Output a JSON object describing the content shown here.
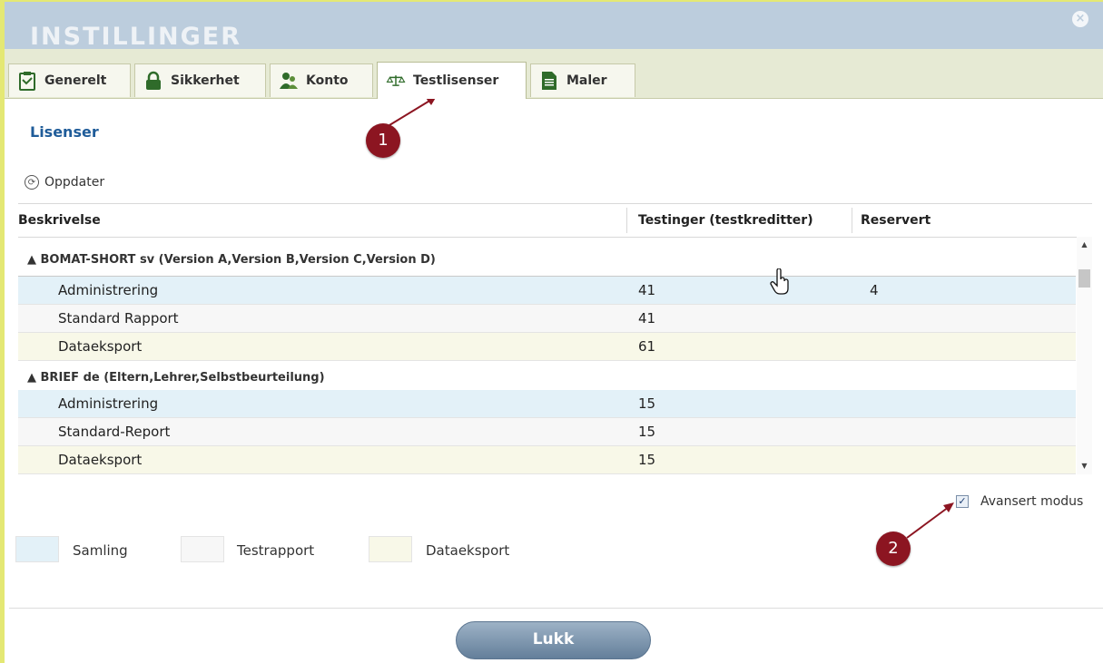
{
  "dialog": {
    "title": "INSTILLINGER",
    "close_symbol": "×"
  },
  "tabs": [
    {
      "label": "Generelt",
      "icon": "clipboard-icon"
    },
    {
      "label": "Sikkerhet",
      "icon": "lock-icon"
    },
    {
      "label": "Konto",
      "icon": "users-icon"
    },
    {
      "label": "Testlisenser",
      "icon": "scale-icon",
      "active": true
    },
    {
      "label": "Maler",
      "icon": "document-icon"
    }
  ],
  "section": {
    "heading": "Lisenser",
    "refresh_label": "Oppdater"
  },
  "table": {
    "headers": [
      "Beskrivelse",
      "Testinger (testkreditter)",
      "Reservert"
    ],
    "groups": [
      {
        "label": "▲ BOMAT-SHORT sv (Version A,Version B,Version C,Version D)",
        "rows": [
          {
            "description": "Administrering",
            "tests": "41",
            "reserved": "4",
            "type": "samling"
          },
          {
            "description": "Standard Rapport",
            "tests": "41",
            "reserved": "",
            "type": "testrapport"
          },
          {
            "description": "Dataeksport",
            "tests": "61",
            "reserved": "",
            "type": "dataeksport"
          }
        ]
      },
      {
        "label": "▲ BRIEF de (Eltern,Lehrer,Selbstbeurteilung)",
        "rows": [
          {
            "description": "Administrering",
            "tests": "15",
            "reserved": "",
            "type": "samling"
          },
          {
            "description": "Standard-Report",
            "tests": "15",
            "reserved": "",
            "type": "testrapport"
          },
          {
            "description": "Dataeksport",
            "tests": "15",
            "reserved": "",
            "type": "dataeksport"
          }
        ]
      }
    ]
  },
  "advanced_mode": {
    "label": "Avansert modus",
    "checked": true
  },
  "legend": [
    {
      "label": "Samling",
      "color": "#e3f1f8"
    },
    {
      "label": "Testrapport",
      "color": "#f7f7f7"
    },
    {
      "label": "Dataeksport",
      "color": "#f8f8e8"
    }
  ],
  "footer": {
    "close_label": "Lukk"
  },
  "annotations": [
    {
      "number": "1"
    },
    {
      "number": "2"
    }
  ],
  "colors": {
    "titlebar": "#bccddd",
    "tabstrip": "#e6ead4",
    "heading": "#1f5c99",
    "badge": "#8c1521",
    "border_accent": "#e4e874"
  }
}
